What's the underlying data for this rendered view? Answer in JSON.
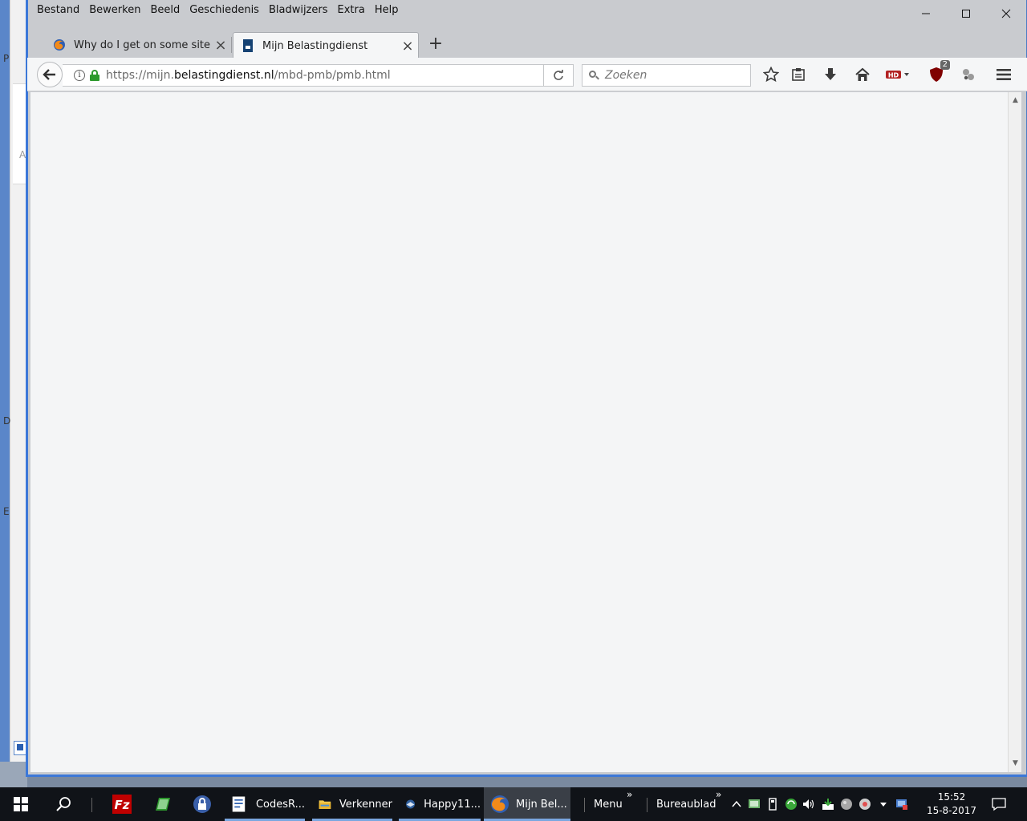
{
  "background_window": {
    "letters": [
      "P",
      "D",
      "E"
    ],
    "side_letter": "A"
  },
  "menu": {
    "items": [
      "Bestand",
      "Bewerken",
      "Beeld",
      "Geschiedenis",
      "Bladwijzers",
      "Extra",
      "Help"
    ]
  },
  "tabs": [
    {
      "title": "Why do I get on some sites t",
      "icon": "firefox-icon",
      "active": false
    },
    {
      "title": "Mijn Belastingdienst",
      "icon": "belastingdienst-icon",
      "active": true
    }
  ],
  "url": {
    "prefix": "https://mijn.",
    "host": "belastingdienst.nl",
    "path": "/mbd-pmb/pmb.html"
  },
  "search": {
    "placeholder": "Zoeken"
  },
  "toolbar": {
    "ublock_badge": "2",
    "hd_label": "HD"
  },
  "taskbar": {
    "buttons": [
      {
        "label": "CodesR...",
        "icon": "document-icon"
      },
      {
        "label": "Verkenner",
        "icon": "folder-icon"
      },
      {
        "label": "Happy11...",
        "icon": "thunderbird-icon"
      },
      {
        "label": "Mijn Bel...",
        "icon": "firefox-icon"
      }
    ],
    "menu_label": "Menu",
    "desktop_label": "Bureaublad",
    "chevron": "»",
    "time": "15:52",
    "date": "15-8-2017"
  },
  "colors": {
    "accent": "#3c78d8",
    "taskbar": "#101318",
    "content_bg": "#f4f5f6"
  }
}
